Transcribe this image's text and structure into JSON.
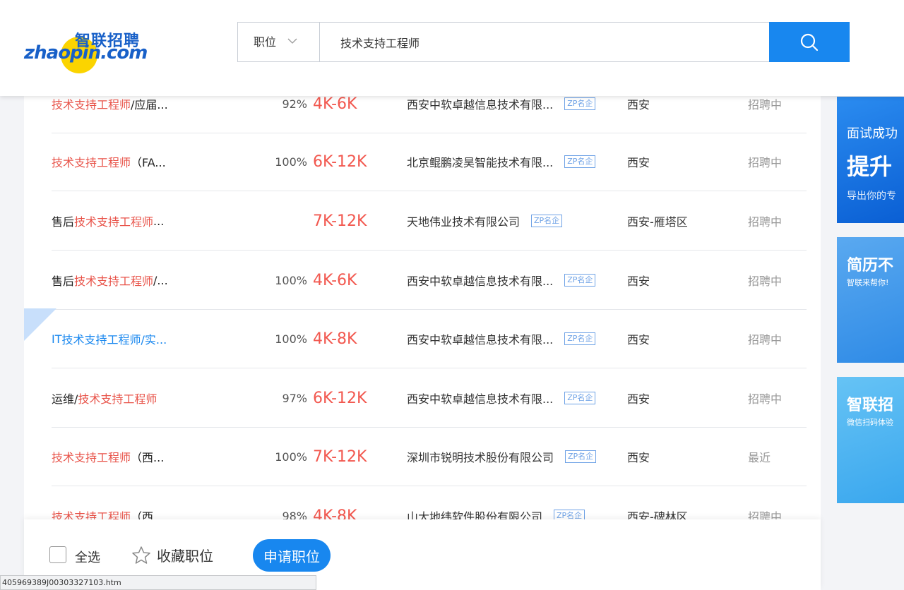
{
  "header": {
    "logo_en": "zhaopin.com",
    "logo_cn": "智联招聘",
    "search_type": "职位",
    "search_query": "技术支持工程师"
  },
  "rows": [
    {
      "title_pre": "",
      "title_hl": "技术支持工程师",
      "title_post": "/应届...",
      "pct": "92%",
      "salary": "4K-6K",
      "company": "西安中软卓越信息技术有限...",
      "badge": "ZP名企",
      "city": "西安",
      "status": "招聘中"
    },
    {
      "title_pre": "",
      "title_hl": "技术支持工程师",
      "title_post": "（FA...",
      "pct": "100%",
      "salary": "6K-12K",
      "company": "北京鲲鹏凌昊智能技术有限...",
      "badge": "ZP名企",
      "city": "西安",
      "status": "招聘中"
    },
    {
      "title_pre": "售后",
      "title_hl": "技术支持工程师",
      "title_post": "...",
      "pct": "",
      "salary": "7K-12K",
      "company": "天地伟业技术有限公司",
      "badge": "ZP名企",
      "city": "西安-雁塔区",
      "status": "招聘中"
    },
    {
      "title_pre": "售后",
      "title_hl": "技术支持工程师",
      "title_post": "/...",
      "pct": "100%",
      "salary": "4K-6K",
      "company": "西安中软卓越信息技术有限...",
      "badge": "ZP名企",
      "city": "西安",
      "status": "招聘中"
    },
    {
      "title_pre": "IT",
      "title_hl": "技术支持工程师",
      "title_post": "/实...",
      "pct": "100%",
      "salary": "4K-8K",
      "company": "西安中软卓越信息技术有限...",
      "badge": "ZP名企",
      "city": "西安",
      "status": "招聘中"
    },
    {
      "title_pre": "运维/",
      "title_hl": "技术支持工程师",
      "title_post": "",
      "pct": "97%",
      "salary": "6K-12K",
      "company": "西安中软卓越信息技术有限...",
      "badge": "ZP名企",
      "city": "西安",
      "status": "招聘中"
    },
    {
      "title_pre": "",
      "title_hl": "技术支持工程师",
      "title_post": "（西...",
      "pct": "100%",
      "salary": "7K-12K",
      "company": "深圳市锐明技术股份有限公司",
      "badge": "ZP名企",
      "city": "西安",
      "status": "最近"
    },
    {
      "title_pre": "",
      "title_hl": "技术支持工程师",
      "title_post": "（西",
      "pct": "98%",
      "salary": "4K-8K",
      "company": "山大地纬软件股份有限公司",
      "badge": "ZP名企",
      "city": "西安-碑林区",
      "status": "招聘中"
    }
  ],
  "bottom": {
    "select_all": "全选",
    "favorite": "收藏职位",
    "apply": "申请职位"
  },
  "statusbar_url": "405969389J00303327103.htm",
  "ads": [
    {
      "line1": "面试成功",
      "line2": "提升",
      "line3": "导出你的专"
    },
    {
      "line1": "简历不",
      "line2": "智联来帮你!"
    },
    {
      "line1": "智联招",
      "line2": "微信扫码体验"
    }
  ],
  "colors": {
    "accent": "#1887ef",
    "salary": "#f2584f",
    "highlight": "#e85248"
  }
}
